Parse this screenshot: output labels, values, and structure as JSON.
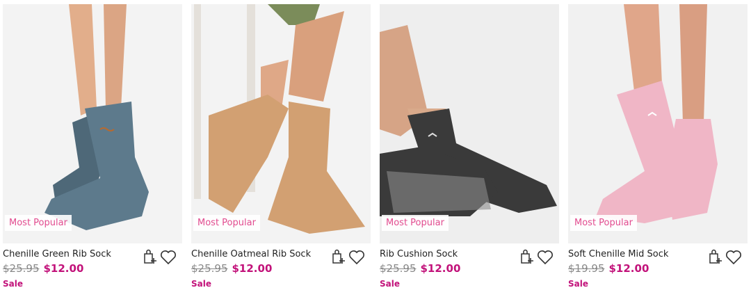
{
  "products": [
    {
      "title": "Chenille Green Rib Sock",
      "was_price": "$25.95",
      "price": "$12.00",
      "badge": "Most Popular",
      "tag": "Sale",
      "sock_color": "#5d7a8c",
      "sock_shade": "#4a6374"
    },
    {
      "title": "Chenille Oatmeal Rib Sock",
      "was_price": "$25.95",
      "price": "$12.00",
      "badge": "Most Popular",
      "tag": "Sale",
      "sock_color": "#d2a072",
      "sock_shade": "#b98553"
    },
    {
      "title": "Rib Cushion Sock",
      "was_price": "$25.95",
      "price": "$12.00",
      "badge": "Most Popular",
      "tag": "Sale",
      "sock_color": "#3a3a3a",
      "sock_shade": "#222222"
    },
    {
      "title": "Soft Chenille Mid Sock",
      "was_price": "$19.95",
      "price": "$12.00",
      "badge": "Most Popular",
      "tag": "Sale",
      "sock_color": "#f0b6c6",
      "sock_shade": "#e49fb2"
    }
  ],
  "icons": {
    "add_to_bag": "shopping-bag-plus-icon",
    "wishlist": "heart-icon"
  },
  "colors": {
    "accent": "#c2127a",
    "badge_text": "#e24b8f",
    "strike": "#888888"
  }
}
